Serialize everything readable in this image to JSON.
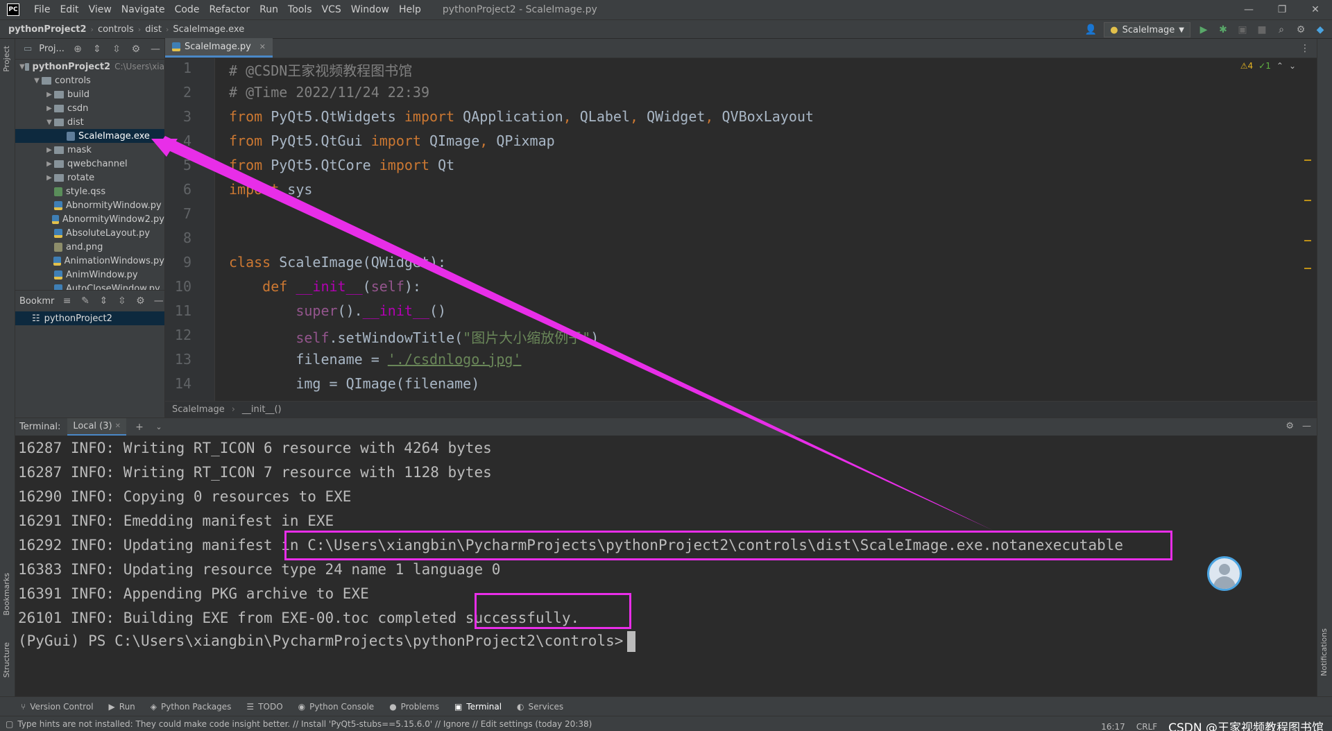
{
  "app": {
    "logo": "PC",
    "window_title": "pythonProject2 - ScaleImage.py"
  },
  "menu": [
    "File",
    "Edit",
    "View",
    "Navigate",
    "Code",
    "Refactor",
    "Run",
    "Tools",
    "VCS",
    "Window",
    "Help"
  ],
  "window_controls": {
    "minimize": "—",
    "restore": "❐",
    "close": "✕"
  },
  "navbar": {
    "crumbs": [
      "pythonProject2",
      "controls",
      "dist",
      "ScaleImage.exe"
    ],
    "run_config": "ScaleImage"
  },
  "stripes": {
    "project": "Project",
    "bookmarks": "Bookmarks",
    "structure": "Structure",
    "notifications": "Notifications"
  },
  "project_panel": {
    "title": "Proj...",
    "root": {
      "label": "pythonProject2",
      "path": "C:\\Users\\xia"
    },
    "tree": [
      {
        "label": "controls",
        "kind": "folder",
        "depth": 1,
        "open": true
      },
      {
        "label": "build",
        "kind": "folder",
        "depth": 2,
        "open": false
      },
      {
        "label": "csdn",
        "kind": "folder",
        "depth": 2,
        "open": false
      },
      {
        "label": "dist",
        "kind": "folder",
        "depth": 2,
        "open": true
      },
      {
        "label": "ScaleImage.exe",
        "kind": "exe",
        "depth": 3,
        "selected": true
      },
      {
        "label": "mask",
        "kind": "folder",
        "depth": 2,
        "open": false
      },
      {
        "label": "qwebchannel",
        "kind": "folder",
        "depth": 2,
        "open": false
      },
      {
        "label": "rotate",
        "kind": "folder",
        "depth": 2,
        "open": false
      },
      {
        "label": "style.qss",
        "kind": "qss",
        "depth": 2
      },
      {
        "label": "AbnormityWindow.py",
        "kind": "py",
        "depth": 2
      },
      {
        "label": "AbnormityWindow2.py",
        "kind": "py",
        "depth": 2
      },
      {
        "label": "AbsoluteLayout.py",
        "kind": "py",
        "depth": 2
      },
      {
        "label": "and.png",
        "kind": "png",
        "depth": 2
      },
      {
        "label": "AnimationWindows.py",
        "kind": "py",
        "depth": 2
      },
      {
        "label": "AnimWindow.py",
        "kind": "py",
        "depth": 2
      },
      {
        "label": "AutoCloseWindow.py",
        "kind": "py",
        "depth": 2
      }
    ]
  },
  "bookmarks_panel": {
    "title": "Bookmr",
    "item": "pythonProject2"
  },
  "editor": {
    "tab": "ScaleImage.py",
    "inspections": {
      "warnings": "⚠4",
      "weak": "✓1"
    },
    "breadcrumb": [
      "ScaleImage",
      "__init__()"
    ]
  },
  "terminal": {
    "label": "Terminal:",
    "tab": "Local (3)",
    "lines": [
      "16287 INFO: Writing RT_ICON 6 resource with 4264 bytes",
      "16287 INFO: Writing RT_ICON 7 resource with 1128 bytes",
      "16290 INFO: Copying 0 resources to EXE",
      "16291 INFO: Emedding manifest in EXE",
      "16292 INFO: Updating manifest in C:\\Users\\xiangbin\\PycharmProjects\\pythonProject2\\controls\\dist\\ScaleImage.exe.notanexecutable",
      "16383 INFO: Updating resource type 24 name 1 language 0",
      "16391 INFO: Appending PKG archive to EXE",
      "26101 INFO: Building EXE from EXE-00.toc completed successfully."
    ],
    "prompt": "(PyGui) PS C:\\Users\\xiangbin\\PycharmProjects\\pythonProject2\\controls>"
  },
  "bottom_tools": [
    "Version Control",
    "Run",
    "Python Packages",
    "TODO",
    "Python Console",
    "Problems",
    "Terminal",
    "Services"
  ],
  "status": {
    "message": "Type hints are not installed: They could make code insight better. // Install 'PyQt5-stubs==5.15.6.0' // Ignore // Edit settings (today 20:38)",
    "position": "16:17",
    "line_sep": "CRLF",
    "watermark": "CSDN @王家视频教程图书馆"
  },
  "colors": {
    "annotation": "#e82ee8",
    "accent": "#4a88c7",
    "keyword": "#cc7832",
    "comment": "#808080",
    "string": "#6a8759"
  }
}
